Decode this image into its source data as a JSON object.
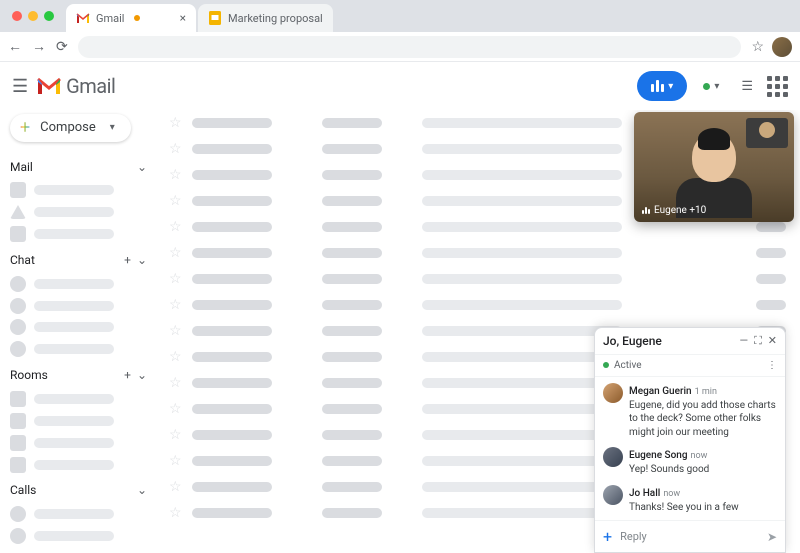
{
  "browser": {
    "tabs": [
      {
        "label": "Gmail"
      },
      {
        "label": "Marketing proposal"
      }
    ]
  },
  "header": {
    "logo_text": "Gmail"
  },
  "sidebar": {
    "compose_label": "Compose",
    "sections": {
      "mail": "Mail",
      "chat": "Chat",
      "rooms": "Rooms",
      "calls": "Calls"
    }
  },
  "pip": {
    "label": "Eugene +10"
  },
  "chat": {
    "title": "Jo, Eugene",
    "status": "Active",
    "messages": [
      {
        "name": "Megan Guerin",
        "time": "1 min",
        "text": "Eugene, did you add those charts to the deck? Some other folks might join our meeting"
      },
      {
        "name": "Eugene Song",
        "time": "now",
        "text": "Yep! Sounds good"
      },
      {
        "name": "Jo Hall",
        "time": "now",
        "text": "Thanks! See you in a few"
      }
    ],
    "reply_placeholder": "Reply"
  }
}
